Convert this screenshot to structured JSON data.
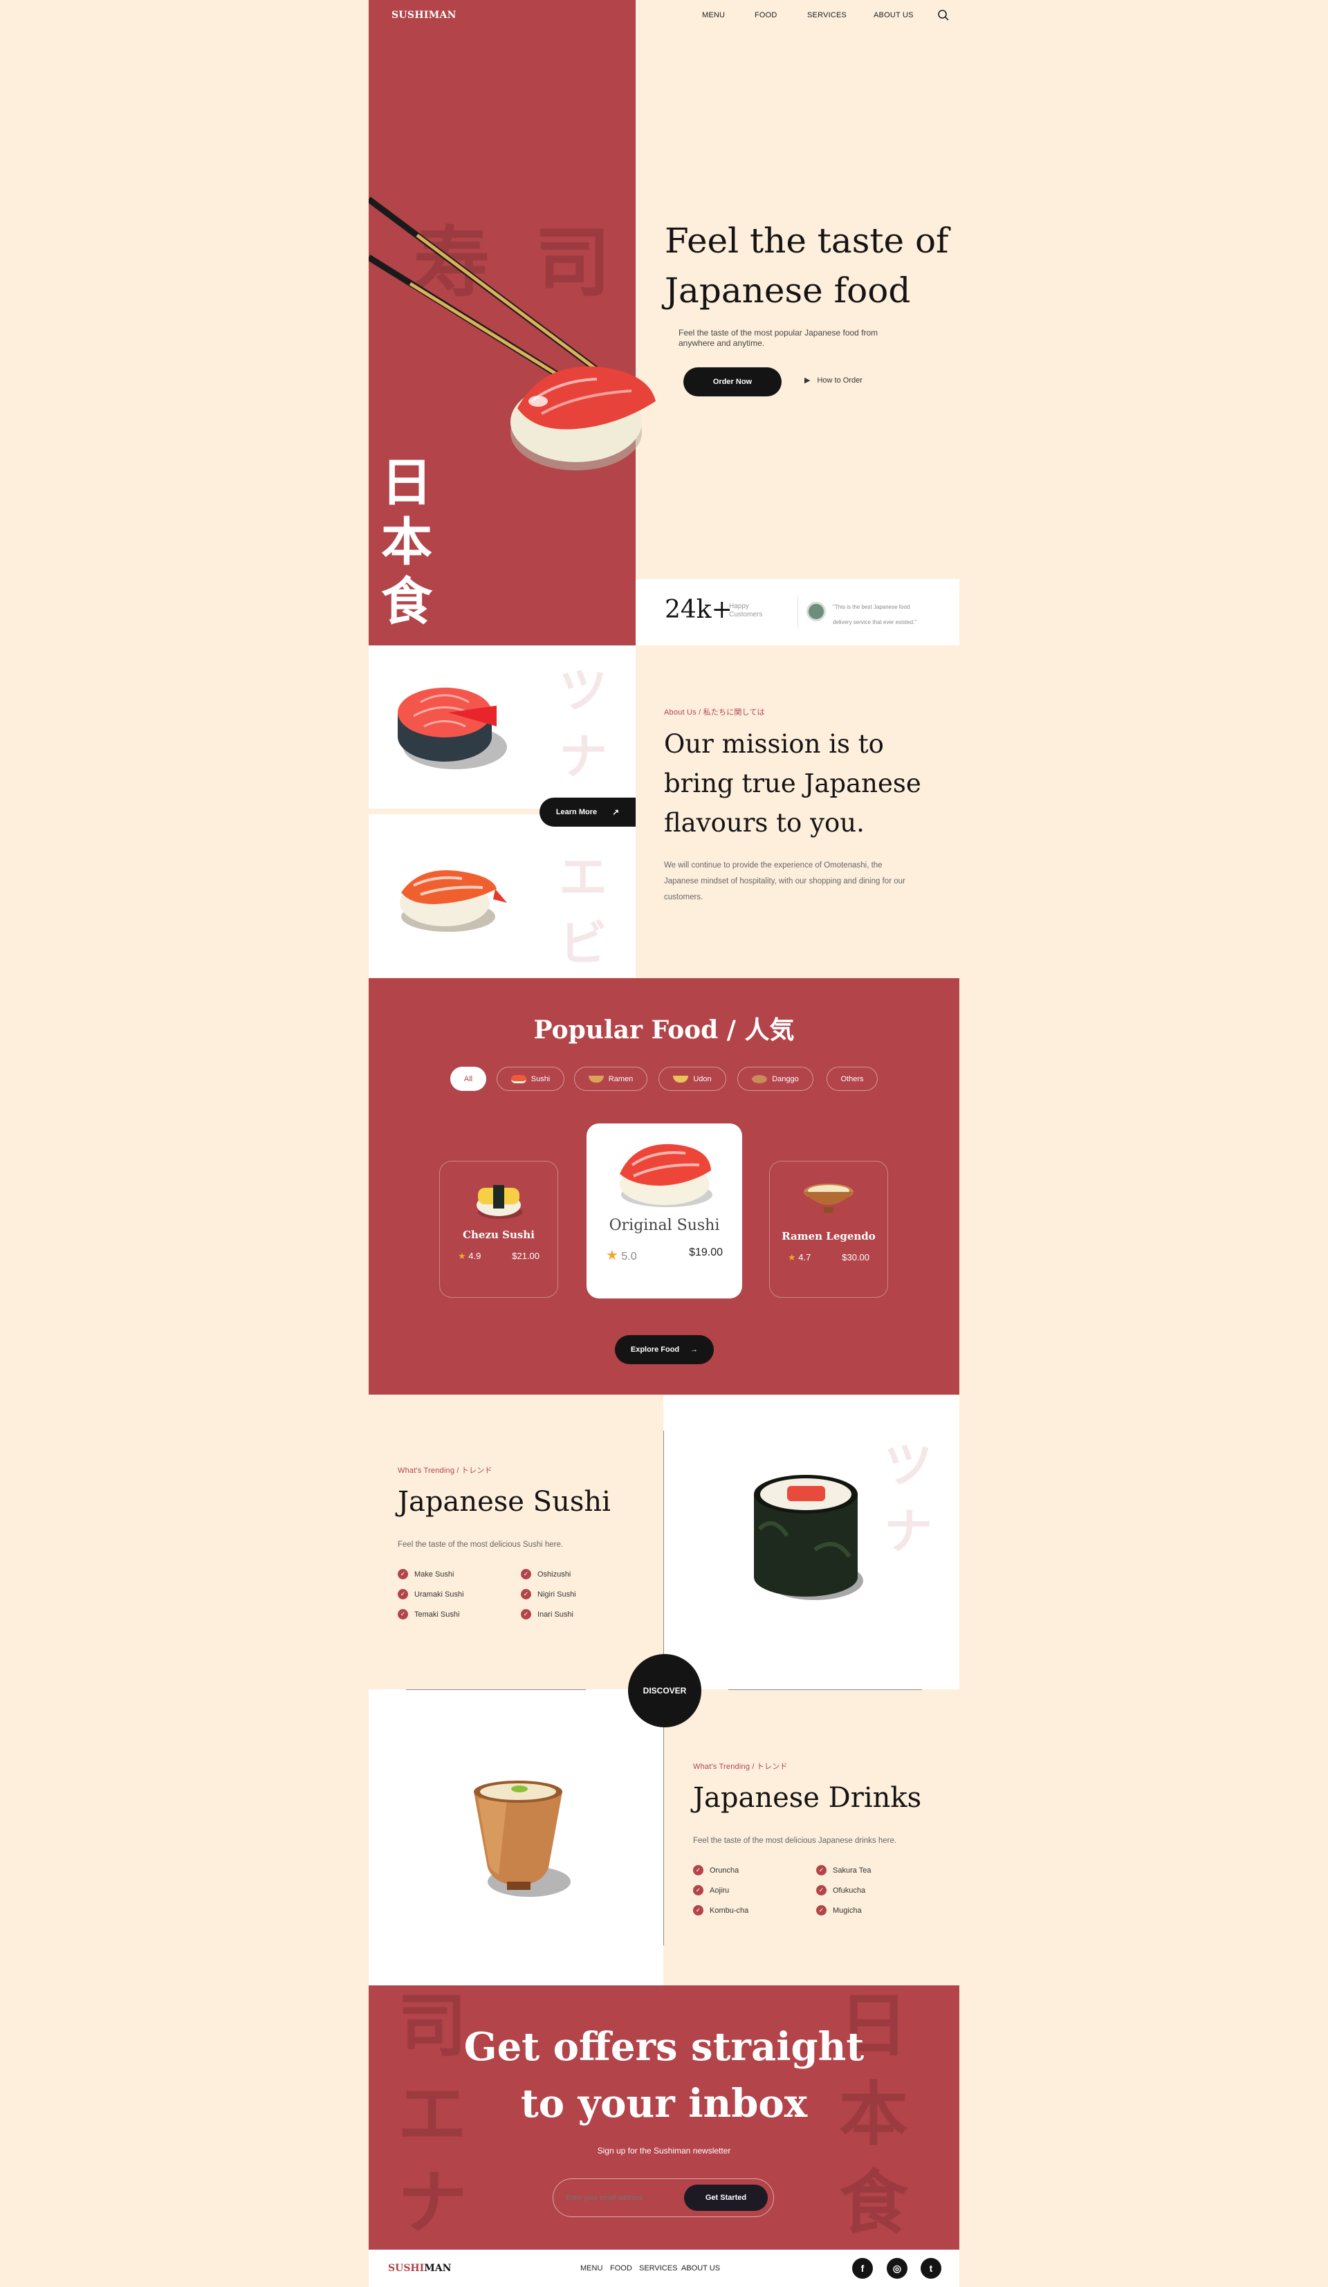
{
  "header": {
    "logo": "SUSHIMAN",
    "nav": [
      "MENU",
      "FOOD",
      "SERVICES",
      "ABOUT US"
    ]
  },
  "hero": {
    "title_line1": "Feel the taste of",
    "title_line2": "Japanese food",
    "subtitle": "Feel the taste of the most popular Japanese food from anywhere and anytime.",
    "order_label": "Order Now",
    "how_label": "How to Order",
    "kanji": [
      "日",
      "本",
      "食"
    ],
    "ghost_kanji": [
      "寿",
      "司"
    ]
  },
  "stats": {
    "number": "24k+",
    "label_line1": "Happy",
    "label_line2": "Customers",
    "quote_line1": "\"This is the best Japanese food",
    "quote_line2": "delivery service that ever existed.\""
  },
  "mission": {
    "eyebrow": "About Us / 私たちに関しては",
    "title_line1": "Our mission is to",
    "title_line2": "bring true Japanese",
    "title_line3": "flavours to you.",
    "body_line1": "We will continue to provide the experience of Omotenashi, the",
    "body_line2": "Japanese mindset of hospitality, with our shopping and dining for our",
    "body_line3": "customers.",
    "learn_label": "Learn More",
    "ghost_tuna": [
      "ツ",
      "ナ"
    ],
    "ghost_ebi": [
      "エ",
      "ビ"
    ]
  },
  "popular": {
    "title": "Popular Food / 人気",
    "filters": [
      "All",
      "Sushi",
      "Ramen",
      "Udon",
      "Danggo",
      "Others"
    ],
    "cards": [
      {
        "name": "Chezu Sushi",
        "rating": "4.9",
        "price": "$21.00"
      },
      {
        "name": "Original Sushi",
        "rating": "5.0",
        "price": "$19.00"
      },
      {
        "name": "Ramen Legendo",
        "rating": "4.7",
        "price": "$30.00"
      }
    ],
    "explore_label": "Explore Food"
  },
  "sushi": {
    "eyebrow": "What's Trending / トレンド",
    "title": "Japanese Sushi",
    "subtitle": "Feel the taste of the most delicious Sushi here.",
    "items": [
      "Make Sushi",
      "Oshizushi",
      "Uramaki Sushi",
      "Nigiri Sushi",
      "Temaki Sushi",
      "Inari Sushi"
    ],
    "ghost": [
      "ツ",
      "ナ"
    ]
  },
  "discover_label": "DISCOVER",
  "drinks": {
    "eyebrow": "What's Trending / トレンド",
    "title": "Japanese Drinks",
    "subtitle": "Feel the taste of the most delicious Japanese drinks here.",
    "items": [
      "Oruncha",
      "Sakura Tea",
      "Aojiru",
      "Ofukucha",
      "Kombu-cha",
      "Mugicha"
    ]
  },
  "newsletter": {
    "title_line1": "Get offers straight",
    "title_line2": "to your inbox",
    "subtitle": "Sign up for the Sushiman newsletter",
    "placeholder": "Enter your email address",
    "button": "Get Started",
    "ghost_left": [
      "司",
      "エ",
      "ナ"
    ],
    "ghost_right": [
      "日",
      "本",
      "食"
    ]
  },
  "footer": {
    "logo_a": "SUSHI",
    "logo_b": "MAN",
    "nav": [
      "MENU",
      "FOOD",
      "SERVICES",
      "ABOUT US"
    ],
    "social": [
      "f",
      "◎",
      "t"
    ]
  },
  "colors": {
    "accent": "#b2444a",
    "background": "#fdefdc",
    "dark": "#151414",
    "star": "#f4a62a"
  }
}
